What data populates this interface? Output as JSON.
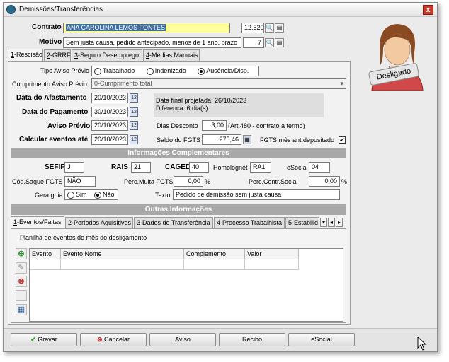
{
  "window": {
    "title": "Demissões/Transferências",
    "close_label": "x"
  },
  "header": {
    "contrato_label": "Contrato",
    "contrato_value": "ANA CAROLINA LEMOS FONTES",
    "contrato_code": "12.520",
    "motivo_label": "Motivo",
    "motivo_value": "Sem justa causa, pedido antecipado, menos de 1 ano, prazo",
    "motivo_code": "7"
  },
  "avatar": {
    "badge": "Desligado"
  },
  "main_tabs": [
    {
      "key": "1",
      "label": "-Rescisão"
    },
    {
      "key": "2",
      "label": "-GRRF"
    },
    {
      "key": "3",
      "label": "-Seguro Desemprego"
    },
    {
      "key": "4",
      "label": "-Médias Manuais"
    }
  ],
  "rescisao": {
    "tipo_aviso_label": "Tipo Aviso Prévio",
    "tipo_aviso_options": [
      "Trabalhado",
      "Indenizado",
      "Ausência/Disp."
    ],
    "tipo_aviso_selected": "Ausência/Disp.",
    "cumprimento_label": "Cumprimento Aviso Prévio",
    "cumprimento_value": "0-Cumprimento total",
    "data_afastamento_label": "Data do Afastamento",
    "data_afastamento": "20/10/2023",
    "data_pagamento_label": "Data do Pagamento",
    "data_pagamento": "30/10/2023",
    "aviso_previo_label": "Aviso Prévio",
    "aviso_previo": "20/10/2023",
    "calcular_label": "Calcular eventos até",
    "calcular": "20/10/2023",
    "data_final_text": "Data final projetada: 26/10/2023",
    "diferenca_text": "Diferença: 6 dia(s)",
    "dias_desconto_label": "Dias Desconto",
    "dias_desconto": "3,00",
    "dias_desconto_note": "(Art.480 - contrato a termo)",
    "saldo_fgts_label": "Saldo do FGTS",
    "saldo_fgts": "275,46",
    "fgts_mes_label": "FGTS mês ant.depositado",
    "fgts_mes_checked": "✔"
  },
  "complementares": {
    "title": "Informações Complementares",
    "sefip_label": "SEFIP",
    "sefip": "J",
    "rais_label": "RAIS",
    "rais": "21",
    "caged_label": "CAGED",
    "caged": "40",
    "homolognet_label": "Homolognet",
    "homolognet": "RA1",
    "esocial_label": "eSocial",
    "esocial": "04",
    "cod_saque_label": "Cód.Saque FGTS",
    "cod_saque": "NÃO",
    "perc_multa_label": "Perc.Multa FGTS",
    "perc_multa": "0,00",
    "perc_contr_label": "Perc.Contr.Social",
    "perc_contr": "0,00",
    "percent_sign": "%",
    "gera_guia_label": "Gera guia",
    "gera_guia_options": [
      "Sim",
      "Não"
    ],
    "gera_guia_selected": "Não",
    "texto_label": "Texto",
    "texto": "Pedido de demissão sem justa causa"
  },
  "outras": {
    "title": "Outras Informações",
    "tabs": [
      {
        "key": "1",
        "label": "-Eventos/Faltas"
      },
      {
        "key": "2",
        "label": "-Períodos Aquisitivos"
      },
      {
        "key": "3",
        "label": "-Dados de Transferência"
      },
      {
        "key": "4",
        "label": "-Processo Trabalhista"
      },
      {
        "key": "5",
        "label": "-Estabilid"
      }
    ],
    "planilha_text": "Planilha de eventos do mês do desligamento",
    "columns": [
      "Evento",
      "Evento.Nome",
      "Complemento",
      "Valor"
    ]
  },
  "footer": {
    "gravar": "Gravar",
    "cancelar": "Cancelar",
    "aviso": "Aviso",
    "recibo": "Recibo",
    "esocial": "eSocial"
  },
  "colors": {
    "section_bg": "#a8a8a8",
    "yellow_field": "#ffff9a",
    "close_red": "#c83a2a"
  }
}
